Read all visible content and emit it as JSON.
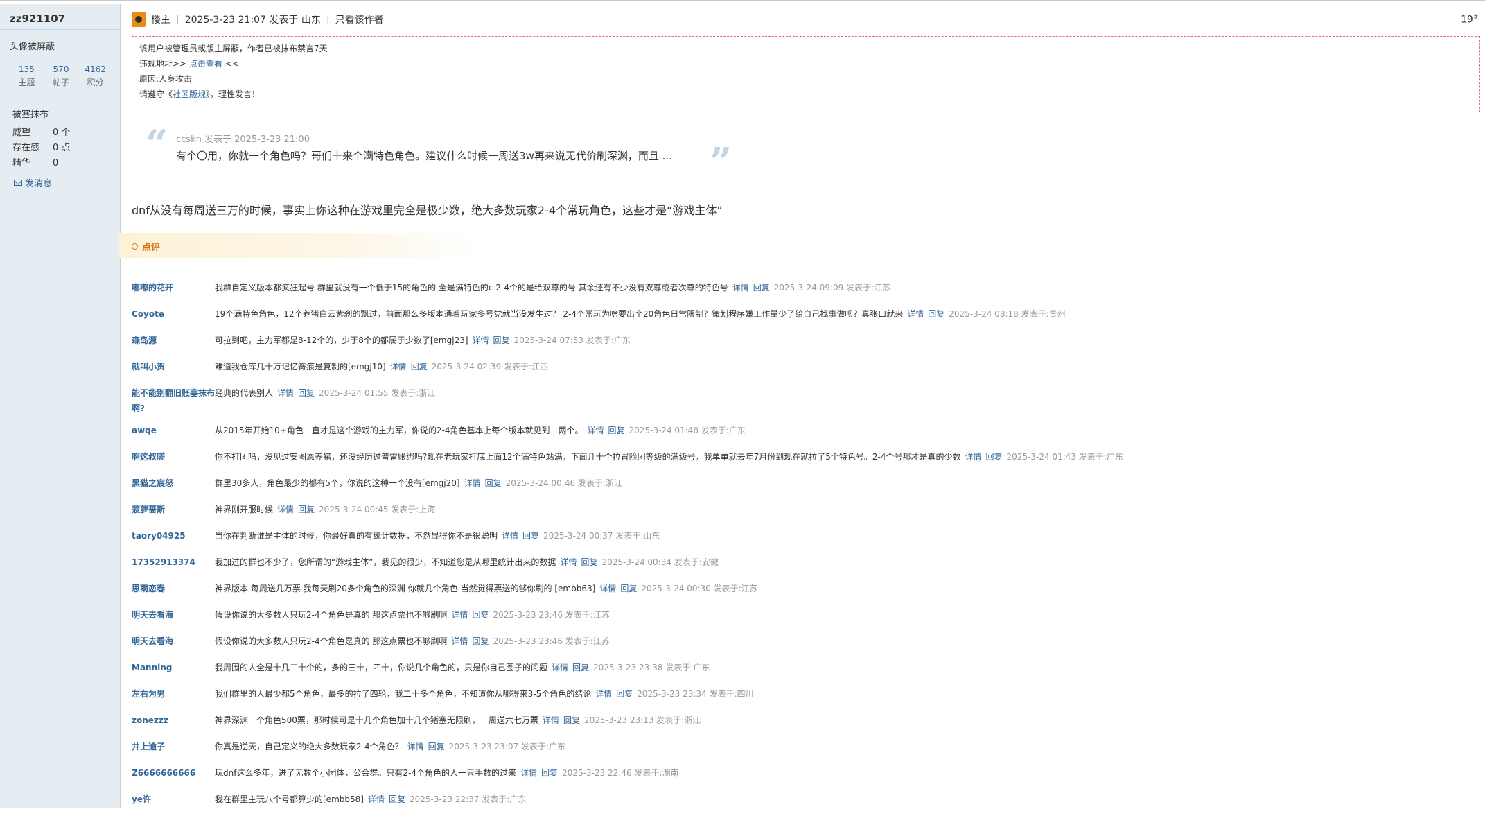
{
  "user": {
    "name": "zz921107",
    "avatar_note": "头像被屏蔽",
    "stats": [
      {
        "num": "135",
        "label": "主题"
      },
      {
        "num": "570",
        "label": "帖子"
      },
      {
        "num": "4162",
        "label": "积分"
      }
    ],
    "group": "被塞抹布",
    "prestige_label": "威望",
    "prestige_value": "0 个",
    "presence_label": "存在感",
    "presence_value": "0 点",
    "essence_label": "精华",
    "essence_value": "0",
    "send_msg": "发消息"
  },
  "post": {
    "role": "楼主",
    "time": "2025-3-23 21:07 发表于 山东",
    "only_author": "只看该作者",
    "floor": "19",
    "floor_sup": "#",
    "notice": {
      "line1": "该用户被管理员或版主屏蔽，作者已被抹布禁言7天",
      "line2_pre": "违规地址>> ",
      "line2_link": "点击查看",
      "line2_post": " <<",
      "line3": "原因:人身攻击",
      "line4_pre": "请遵守《",
      "line4_link": "社区版规",
      "line4_post": "》，理性发言！"
    },
    "quote": {
      "meta": "ccskn 发表于 2025-3-23 21:00",
      "text": "有个〇用，你就一个角色吗？哥们十来个满特色角色。建议什么时候一周送3w再来说无代价刷深渊，而且 ..."
    },
    "body": "dnf从没有每周送三万的时候，事实上你这种在游戏里完全是极少数，绝大多数玩家2-4个常玩角色，这些才是“游戏主体”"
  },
  "dianping": {
    "title": "点评",
    "detail_label": "详情",
    "reply_label": "回复",
    "comments": [
      {
        "author": "嘟嘟的花开",
        "text": "我群自定义版本都疯狂起号 群里就没有一个低于15的角色的 全是满特色的c 2-4个的是给双尊的号 其余还有不少没有双尊或者次尊的特色号",
        "time": "2025-3-24 09:09 发表于:江苏"
      },
      {
        "author": "Coyote",
        "text": "19个满特色角色，12个养猪白云紫刹的飘过，前面那么多版本通着玩家多号党就当没发生过？ 2-4个常玩为啥要出个20角色日常限制？策划程序嫌工作量少了给自己找事做呗？真张口就来",
        "time": "2025-3-24 08:18 发表于:贵州"
      },
      {
        "author": "森岛源",
        "text": "可拉到吧，主力军都是8-12个的，少于8个的都属于少数了[emgj23]",
        "time": "2025-3-24 07:53 发表于:广东"
      },
      {
        "author": "就叫小贺",
        "text": "难道我仓库几十万记忆篝痕是复制的[emgj10]",
        "time": "2025-3-24 02:39 发表于:江西"
      },
      {
        "author": "能不能别翻旧账塞抹布啊?",
        "text": "经典的代表别人",
        "time": "2025-3-24 01:55 发表于:浙江"
      },
      {
        "author": "awqe",
        "text": "从2015年开始10+角色一直才是这个游戏的主力军，你说的2-4角色基本上每个版本就见到一两个。",
        "time": "2025-3-24 01:48 发表于:广东"
      },
      {
        "author": "啊这叔嗟",
        "text": "你不打团吗，没见过安图恩养猪，还没经历过普雷账绑吗?现在老玩家打底上面12个满特色站满，下面几十个拉冒险团等级的满级号，我单单就去年7月份到现在就拉了5个特色号。2-4个号那才是真的少数",
        "time": "2025-3-24 01:43 发表于:广东"
      },
      {
        "author": "黑猫之宸怒",
        "text": "群里30多人，角色最少的都有5个，你说的这种一个没有[emgj20]",
        "time": "2025-3-24 00:46 发表于:浙江"
      },
      {
        "author": "菠萝蔷斯",
        "text": "神界刚开服时候",
        "time": "2025-3-24 00:45 发表于:上海"
      },
      {
        "author": "taory04925",
        "text": "当你在判断谁是主体的时候，你最好真的有统计数据，不然显得你不是很聪明",
        "time": "2025-3-24 00:37 发表于:山东"
      },
      {
        "author": "17352913374",
        "text": "我加过的群也不少了，您所谓的“游戏主体”，我见的很少，不知道您是从哪里统计出来的数据",
        "time": "2025-3-24 00:34 发表于:安徽"
      },
      {
        "author": "思雨恋春",
        "text": "神界版本 每周送几万票 我每天刷20多个角色的深渊 你就几个角色 当然觉得票送的够你刷的 [embb63]",
        "time": "2025-3-24 00:30 发表于:江苏"
      },
      {
        "author": "明天去看海",
        "text": "假设你说的大多数人只玩2-4个角色是真的 那这点票也不够刷啊",
        "time": "2025-3-23 23:46 发表于:江苏"
      },
      {
        "author": "明天去看海",
        "text": "假设你说的大多数人只玩2-4个角色是真的 那这点票也不够刷啊",
        "time": "2025-3-23 23:46 发表于:江苏"
      },
      {
        "author": "Manning",
        "text": "我周围的人全是十几二十个的，多的三十，四十，你说几个角色的，只是你自己圈子的问题",
        "time": "2025-3-23 23:38 发表于:广东"
      },
      {
        "author": "左右为男",
        "text": "我们群里的人最少都5个角色，最多的拉了四轮，我二十多个角色，不知道你从哪得来3-5个角色的结论",
        "time": "2025-3-23 23:34 发表于:四川"
      },
      {
        "author": "zonezzz",
        "text": "神界深渊一个角色500票，那时候可是十几个角色加十几个猪塞无限刷，一周送六七万票",
        "time": "2025-3-23 23:13 发表于:浙江"
      },
      {
        "author": "井上逾子",
        "text": "你真是逆天，自己定义的绝大多数玩家2-4个角色？",
        "time": "2025-3-23 23:07 发表于:广东"
      },
      {
        "author": "Z6666666666",
        "text": "玩dnf这么多年，进了无数个小团体，公会群。只有2-4个角色的人一只手数的过来",
        "time": "2025-3-23 22:46 发表于:湖南"
      },
      {
        "author": "ye许",
        "text": "我在群里主玩八个号都算少的[embb58]",
        "time": "2025-3-23 22:37 发表于:广东"
      }
    ]
  }
}
